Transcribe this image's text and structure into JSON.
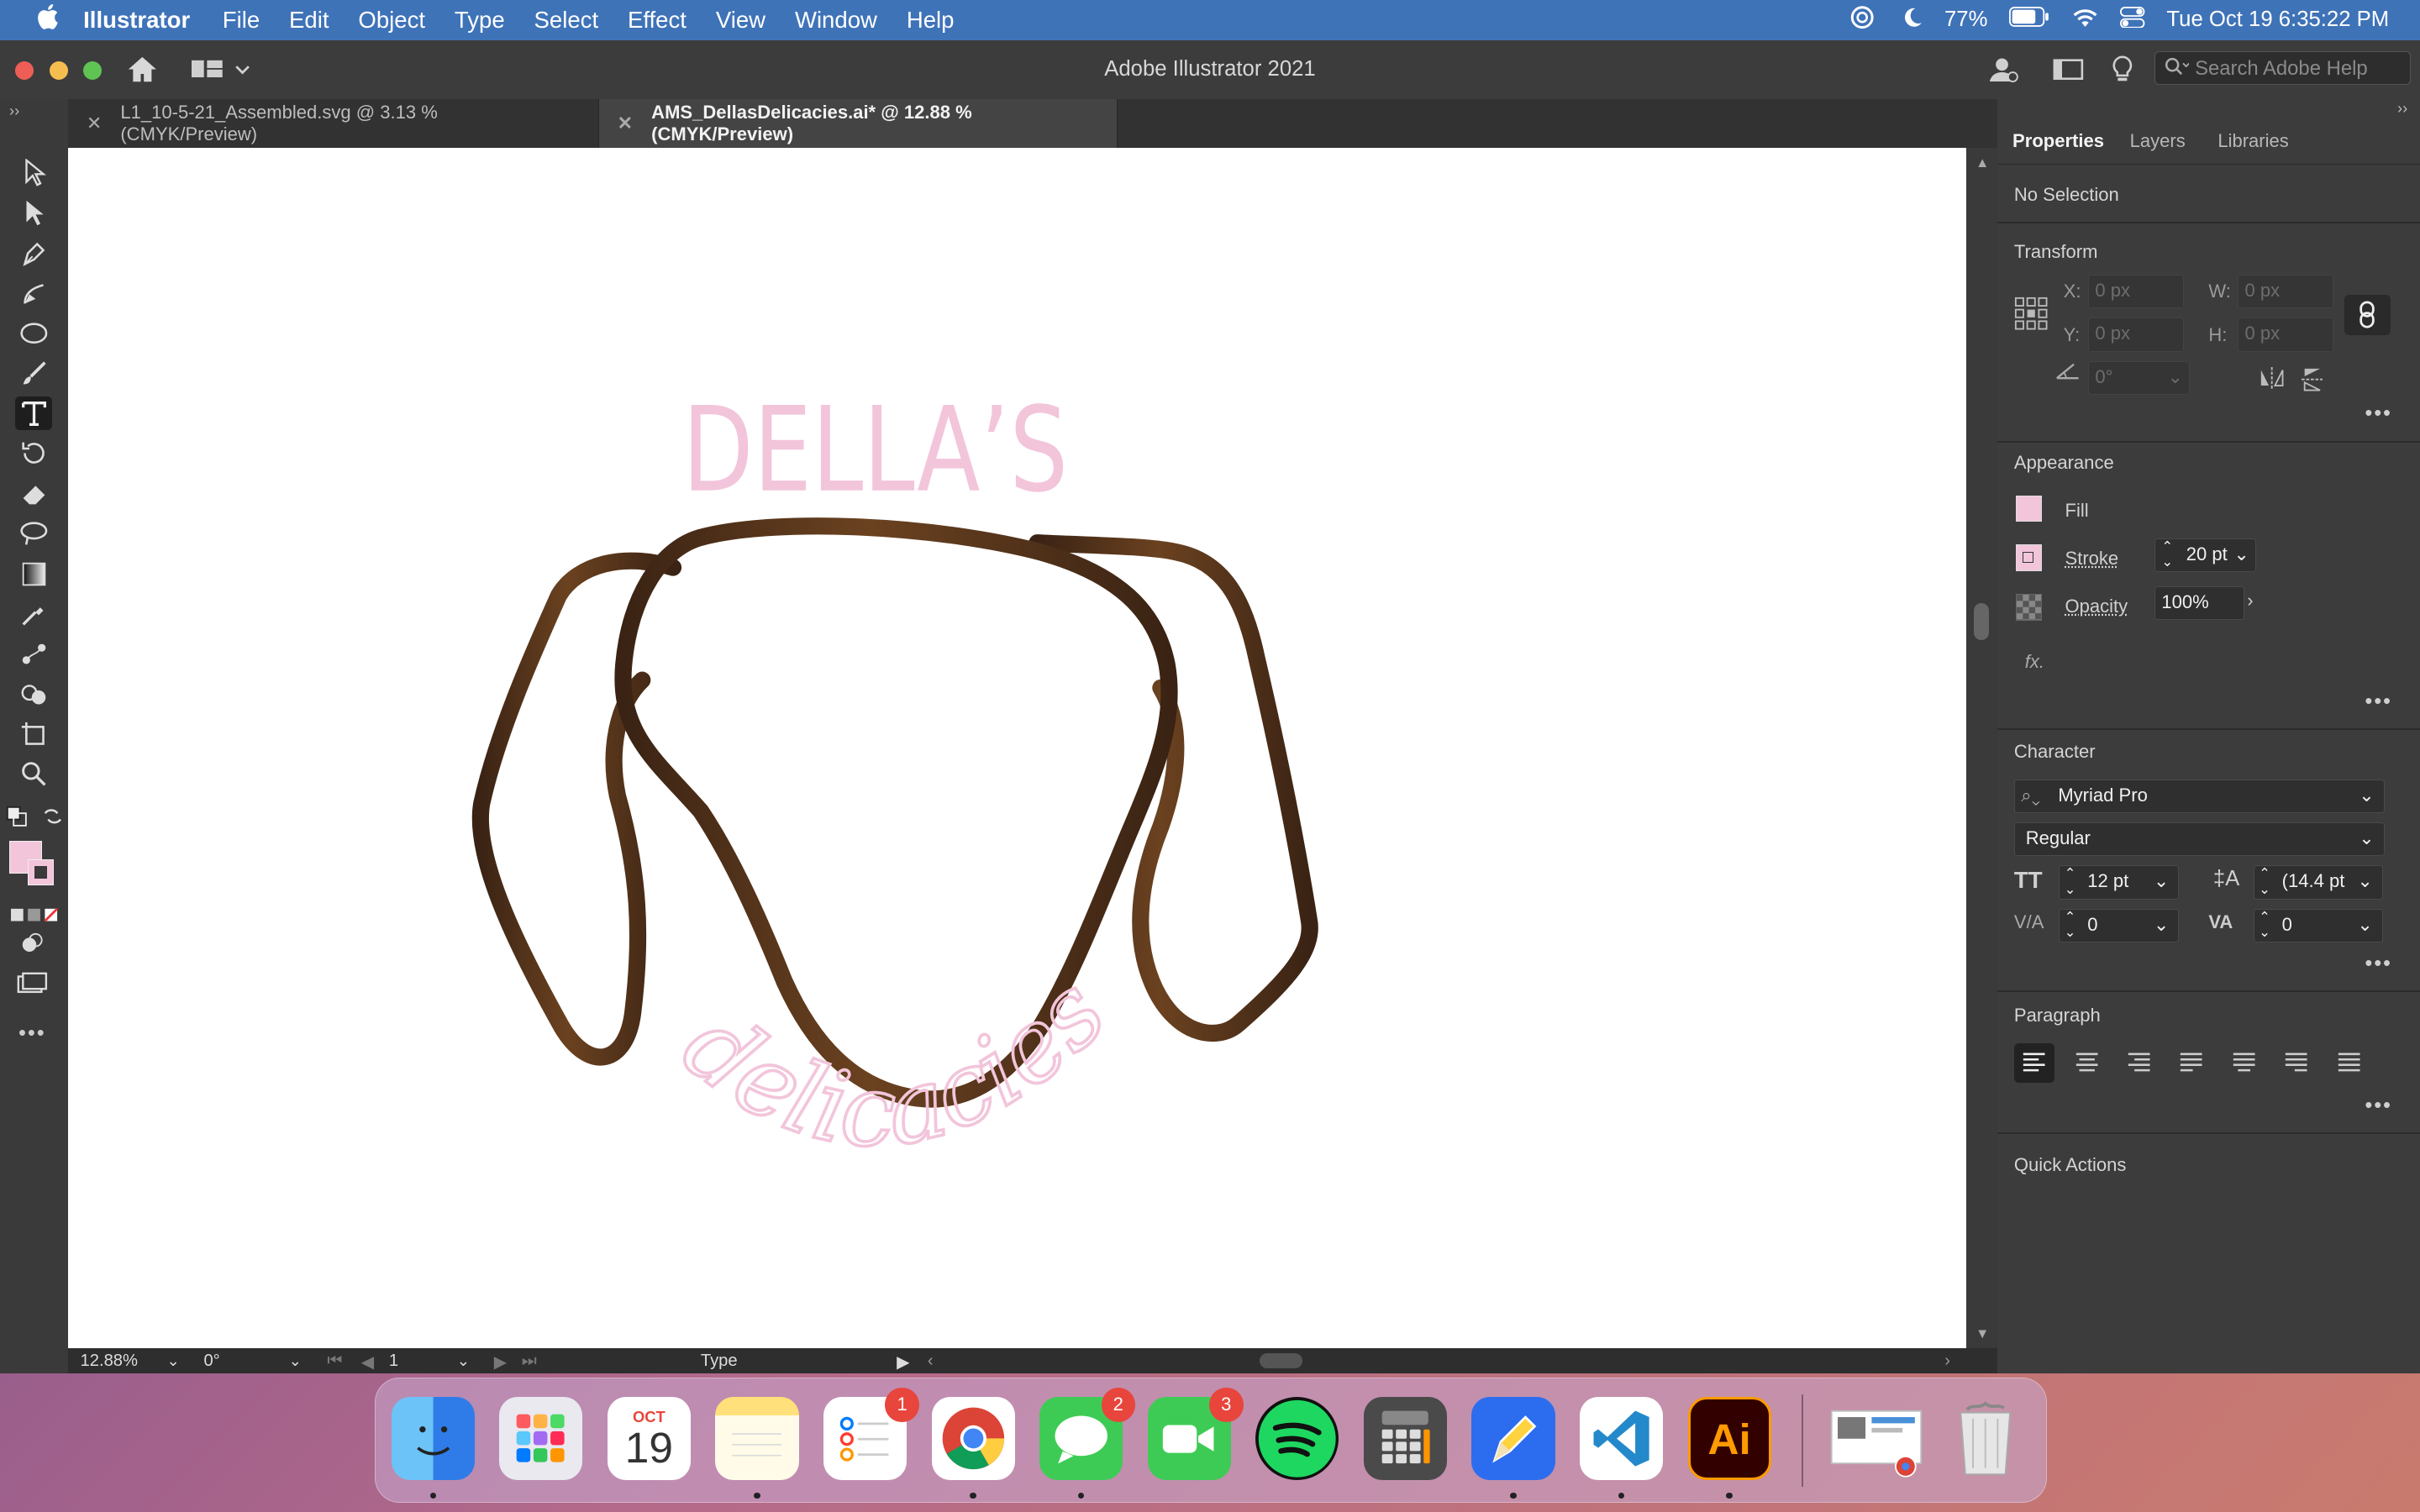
{
  "menubar": {
    "app_name": "Illustrator",
    "items": [
      "File",
      "Edit",
      "Object",
      "Type",
      "Select",
      "Effect",
      "View",
      "Window",
      "Help"
    ],
    "battery": "77%",
    "datetime": "Tue Oct 19  6:35:22 PM"
  },
  "window": {
    "title": "Adobe Illustrator 2021",
    "search_placeholder": "Search Adobe Help"
  },
  "doc_tabs": [
    {
      "label": "L1_10-5-21_Assembled.svg @ 3.13 % (CMYK/Preview)",
      "active": false
    },
    {
      "label": "AMS_DellasDelicacies.ai* @ 12.88 % (CMYK/Preview)",
      "active": true
    }
  ],
  "artwork": {
    "headline": "DELLA’S",
    "script_text": "delicacies",
    "headline_color": "#f2c5db",
    "outline_color_dark": "#3a2314",
    "outline_color_light": "#6b4220"
  },
  "statusbar": {
    "zoom": "12.88%",
    "rotation": "0°",
    "artboard": "1",
    "tool": "Type"
  },
  "panel": {
    "tabs": [
      "Properties",
      "Layers",
      "Libraries"
    ],
    "selection": "No Selection",
    "transform": {
      "title": "Transform",
      "x_label": "X:",
      "x_value": "0 px",
      "y_label": "Y:",
      "y_value": "0 px",
      "w_label": "W:",
      "w_value": "0 px",
      "h_label": "H:",
      "h_value": "0 px",
      "angle_value": "0°"
    },
    "appearance": {
      "title": "Appearance",
      "fill_label": "Fill",
      "stroke_label": "Stroke",
      "stroke_value": "20 pt",
      "opacity_label": "Opacity",
      "opacity_value": "100%",
      "fx_label": "fx."
    },
    "character": {
      "title": "Character",
      "font_family": "Myriad Pro",
      "font_style": "Regular",
      "font_size": "12 pt",
      "leading": "(14.4 pt",
      "kerning": "0",
      "tracking": "0"
    },
    "paragraph_title": "Paragraph",
    "quick_actions_title": "Quick Actions"
  },
  "dock": {
    "calendar_month": "OCT",
    "calendar_day": "19",
    "reminders_badge": "1",
    "messages_badge": "2",
    "facetime_badge": "3",
    "illustrator_label": "Ai"
  }
}
